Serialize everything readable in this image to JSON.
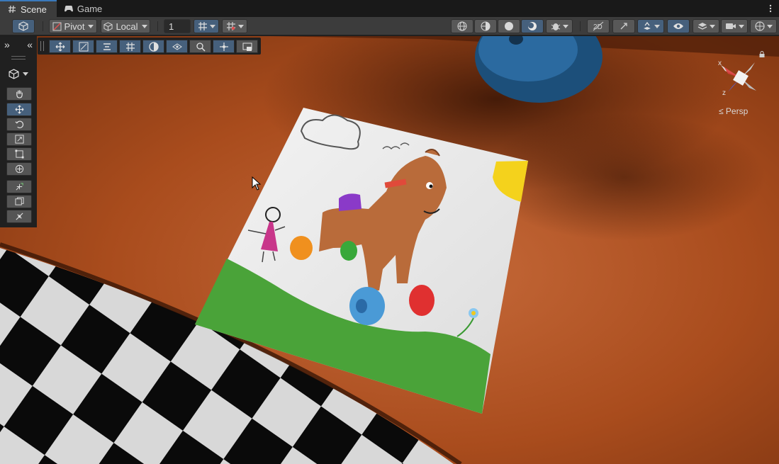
{
  "tabs": [
    {
      "label": "Scene",
      "icon": "hash-icon",
      "active": true
    },
    {
      "label": "Game",
      "icon": "gamepad-icon",
      "active": false
    }
  ],
  "toolbar": {
    "pivot_label": "Pivot",
    "local_label": "Local",
    "grid_size_value": "1"
  },
  "left_tools": {
    "collapse_label": "»",
    "expand_label": "«"
  },
  "gizmo": {
    "x_label": "x",
    "z_label": "z",
    "persp_label": "≤ Persp"
  },
  "colors": {
    "accent": "#46607c",
    "table": "#a84a1c",
    "tab_highlight": "#3a79bb"
  }
}
